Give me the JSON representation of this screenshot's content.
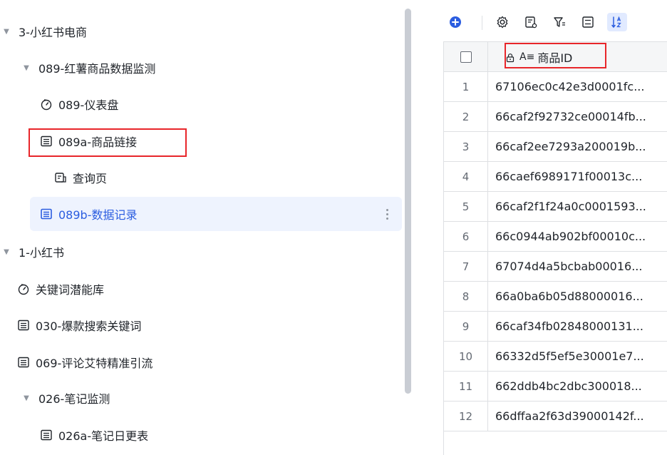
{
  "sidebar": {
    "items": [
      {
        "label": "3-小红书电商",
        "icon": "caret-down-icon",
        "kind": "folder"
      },
      {
        "label": "089-红薯商品数据监测",
        "icon": "caret-down-icon",
        "kind": "folder"
      },
      {
        "label": "089-仪表盘",
        "icon": "dashboard-icon",
        "kind": "dashboard"
      },
      {
        "label": "089a-商品链接",
        "icon": "table-icon",
        "kind": "table"
      },
      {
        "label": "查询页",
        "icon": "form-icon",
        "kind": "form"
      },
      {
        "label": "089b-数据记录",
        "icon": "table-icon",
        "kind": "table",
        "active": true
      },
      {
        "label": "1-小红书",
        "icon": "caret-down-icon",
        "kind": "folder"
      },
      {
        "label": "关键词潜能库",
        "icon": "dashboard-icon",
        "kind": "dashboard"
      },
      {
        "label": "030-爆款搜索关键词",
        "icon": "table-icon",
        "kind": "table"
      },
      {
        "label": "069-评论艾特精准引流",
        "icon": "table-icon",
        "kind": "table"
      },
      {
        "label": "026-笔记监测",
        "icon": "caret-down-icon",
        "kind": "folder"
      },
      {
        "label": "026a-笔记日更表",
        "icon": "table-icon",
        "kind": "table"
      }
    ],
    "more_icon": "more-vertical-icon"
  },
  "toolbar": {
    "icons": [
      "add-circle-icon",
      "settings-icon",
      "field-settings-icon",
      "filter-icon",
      "group-icon",
      "sort-icon"
    ]
  },
  "table": {
    "column_header": "商品ID",
    "column_type_glyph": "A≡",
    "rows": [
      {
        "index": "1",
        "value": "67106ec0c42e3d0001fc..."
      },
      {
        "index": "2",
        "value": "66caf2f92732ce00014fb..."
      },
      {
        "index": "3",
        "value": "66caf2ee7293a200019b..."
      },
      {
        "index": "4",
        "value": "66caef6989171f00013c..."
      },
      {
        "index": "5",
        "value": "66caf2f1f24a0c0001593..."
      },
      {
        "index": "6",
        "value": "66c0944ab902bf00010c..."
      },
      {
        "index": "7",
        "value": "67074d4a5bcbab00016..."
      },
      {
        "index": "8",
        "value": "66a0ba6b05d88000016..."
      },
      {
        "index": "9",
        "value": "66caf34fb02848000131..."
      },
      {
        "index": "10",
        "value": "66332d5f5ef5e30001e7..."
      },
      {
        "index": "11",
        "value": "662ddb4bc2dbc300018..."
      },
      {
        "index": "12",
        "value": "66dffaa2f63d39000142f..."
      }
    ]
  },
  "colors": {
    "accent": "#2b5de0",
    "active_bg": "#eef3fe",
    "highlight": "#e8262a",
    "border": "#dee0e3"
  }
}
